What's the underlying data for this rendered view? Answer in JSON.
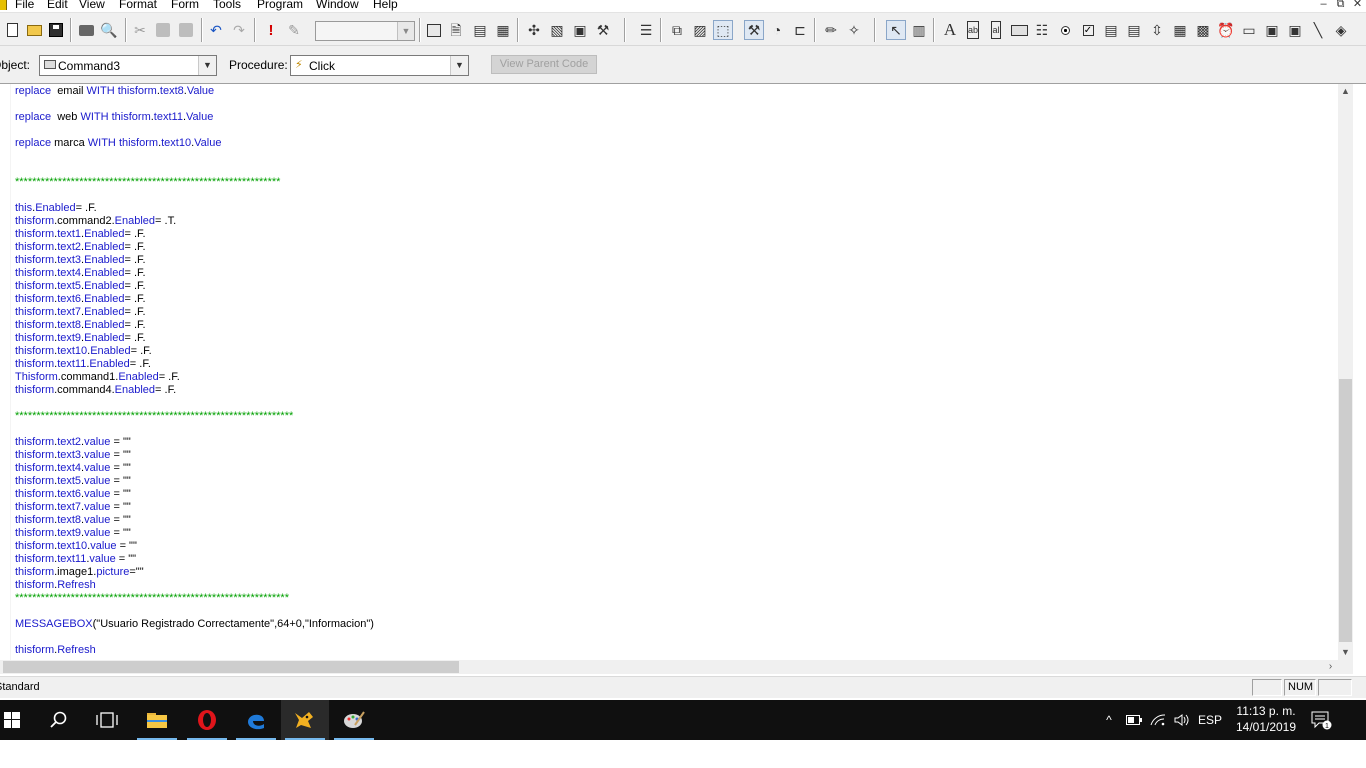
{
  "menubar": {
    "items": [
      "File",
      "Edit",
      "View",
      "Format",
      "Form",
      "Tools",
      "Program",
      "Window",
      "Help"
    ],
    "window_controls": [
      "–",
      "⧉",
      "✕"
    ]
  },
  "toolbar": {
    "combo_value": ""
  },
  "object_bar": {
    "object_label": "Object:",
    "object_value": "Command3",
    "procedure_label": "Procedure:",
    "procedure_value": "Click",
    "view_parent_label": "View Parent Code"
  },
  "code": {
    "lines": [
      [
        [
          "kw",
          "replace"
        ],
        [
          "pl",
          "  email "
        ],
        [
          "kw",
          "WITH"
        ],
        [
          "pl",
          " "
        ],
        [
          "kw",
          "thisform"
        ],
        [
          "pl",
          "."
        ],
        [
          "kw",
          "text8"
        ],
        [
          "pl",
          "."
        ],
        [
          "kw",
          "Value"
        ]
      ],
      [],
      [
        [
          "kw",
          "replace"
        ],
        [
          "pl",
          "  web "
        ],
        [
          "kw",
          "WITH"
        ],
        [
          "pl",
          " "
        ],
        [
          "kw",
          "thisform"
        ],
        [
          "pl",
          "."
        ],
        [
          "kw",
          "text11"
        ],
        [
          "pl",
          "."
        ],
        [
          "kw",
          "Value"
        ]
      ],
      [],
      [
        [
          "kw",
          "replace"
        ],
        [
          "pl",
          " marca "
        ],
        [
          "kw",
          "WITH"
        ],
        [
          "pl",
          " "
        ],
        [
          "kw",
          "thisform"
        ],
        [
          "pl",
          "."
        ],
        [
          "kw",
          "text10"
        ],
        [
          "pl",
          "."
        ],
        [
          "kw",
          "Value"
        ]
      ],
      [],
      [],
      [
        [
          "cm",
          "**************************************************************"
        ]
      ],
      [],
      [
        [
          "kw",
          "this"
        ],
        [
          "pl",
          "."
        ],
        [
          "kw",
          "Enabled"
        ],
        [
          "pl",
          "= .F."
        ]
      ],
      [
        [
          "kw",
          "thisform"
        ],
        [
          "pl",
          ".command2."
        ],
        [
          "kw",
          "Enabled"
        ],
        [
          "pl",
          "= .T."
        ]
      ],
      [
        [
          "kw",
          "thisform"
        ],
        [
          "pl",
          "."
        ],
        [
          "kw",
          "text1"
        ],
        [
          "pl",
          "."
        ],
        [
          "kw",
          "Enabled"
        ],
        [
          "pl",
          "= .F."
        ]
      ],
      [
        [
          "kw",
          "thisform"
        ],
        [
          "pl",
          "."
        ],
        [
          "kw",
          "text2"
        ],
        [
          "pl",
          "."
        ],
        [
          "kw",
          "Enabled"
        ],
        [
          "pl",
          "= .F."
        ]
      ],
      [
        [
          "kw",
          "thisform"
        ],
        [
          "pl",
          "."
        ],
        [
          "kw",
          "text3"
        ],
        [
          "pl",
          "."
        ],
        [
          "kw",
          "Enabled"
        ],
        [
          "pl",
          "= .F."
        ]
      ],
      [
        [
          "kw",
          "thisform"
        ],
        [
          "pl",
          "."
        ],
        [
          "kw",
          "text4"
        ],
        [
          "pl",
          "."
        ],
        [
          "kw",
          "Enabled"
        ],
        [
          "pl",
          "= .F."
        ]
      ],
      [
        [
          "kw",
          "thisform"
        ],
        [
          "pl",
          "."
        ],
        [
          "kw",
          "text5"
        ],
        [
          "pl",
          "."
        ],
        [
          "kw",
          "Enabled"
        ],
        [
          "pl",
          "= .F."
        ]
      ],
      [
        [
          "kw",
          "thisform"
        ],
        [
          "pl",
          "."
        ],
        [
          "kw",
          "text6"
        ],
        [
          "pl",
          "."
        ],
        [
          "kw",
          "Enabled"
        ],
        [
          "pl",
          "= .F."
        ]
      ],
      [
        [
          "kw",
          "thisform"
        ],
        [
          "pl",
          "."
        ],
        [
          "kw",
          "text7"
        ],
        [
          "pl",
          "."
        ],
        [
          "kw",
          "Enabled"
        ],
        [
          "pl",
          "= .F."
        ]
      ],
      [
        [
          "kw",
          "thisform"
        ],
        [
          "pl",
          "."
        ],
        [
          "kw",
          "text8"
        ],
        [
          "pl",
          "."
        ],
        [
          "kw",
          "Enabled"
        ],
        [
          "pl",
          "= .F."
        ]
      ],
      [
        [
          "kw",
          "thisform"
        ],
        [
          "pl",
          "."
        ],
        [
          "kw",
          "text9"
        ],
        [
          "pl",
          "."
        ],
        [
          "kw",
          "Enabled"
        ],
        [
          "pl",
          "= .F."
        ]
      ],
      [
        [
          "kw",
          "thisform"
        ],
        [
          "pl",
          "."
        ],
        [
          "kw",
          "text10"
        ],
        [
          "pl",
          "."
        ],
        [
          "kw",
          "Enabled"
        ],
        [
          "pl",
          "= .F."
        ]
      ],
      [
        [
          "kw",
          "thisform"
        ],
        [
          "pl",
          "."
        ],
        [
          "kw",
          "text11"
        ],
        [
          "pl",
          "."
        ],
        [
          "kw",
          "Enabled"
        ],
        [
          "pl",
          "= .F."
        ]
      ],
      [
        [
          "kw",
          "Thisform"
        ],
        [
          "pl",
          ".command1."
        ],
        [
          "kw",
          "Enabled"
        ],
        [
          "pl",
          "= .F."
        ]
      ],
      [
        [
          "kw",
          "thisform"
        ],
        [
          "pl",
          ".command4."
        ],
        [
          "kw",
          "Enabled"
        ],
        [
          "pl",
          "= .F."
        ]
      ],
      [],
      [
        [
          "cm",
          "*****************************************************************"
        ]
      ],
      [],
      [
        [
          "kw",
          "thisform"
        ],
        [
          "pl",
          "."
        ],
        [
          "kw",
          "text2"
        ],
        [
          "pl",
          "."
        ],
        [
          "kw",
          "value"
        ],
        [
          "pl",
          " = \"\""
        ]
      ],
      [
        [
          "kw",
          "thisform"
        ],
        [
          "pl",
          "."
        ],
        [
          "kw",
          "text3"
        ],
        [
          "pl",
          "."
        ],
        [
          "kw",
          "value"
        ],
        [
          "pl",
          " = \"\""
        ]
      ],
      [
        [
          "kw",
          "thisform"
        ],
        [
          "pl",
          "."
        ],
        [
          "kw",
          "text4"
        ],
        [
          "pl",
          "."
        ],
        [
          "kw",
          "value"
        ],
        [
          "pl",
          " = \"\""
        ]
      ],
      [
        [
          "kw",
          "thisform"
        ],
        [
          "pl",
          "."
        ],
        [
          "kw",
          "text5"
        ],
        [
          "pl",
          "."
        ],
        [
          "kw",
          "value"
        ],
        [
          "pl",
          " = \"\""
        ]
      ],
      [
        [
          "kw",
          "thisform"
        ],
        [
          "pl",
          "."
        ],
        [
          "kw",
          "text6"
        ],
        [
          "pl",
          "."
        ],
        [
          "kw",
          "value"
        ],
        [
          "pl",
          " = \"\""
        ]
      ],
      [
        [
          "kw",
          "thisform"
        ],
        [
          "pl",
          "."
        ],
        [
          "kw",
          "text7"
        ],
        [
          "pl",
          "."
        ],
        [
          "kw",
          "value"
        ],
        [
          "pl",
          " = \"\""
        ]
      ],
      [
        [
          "kw",
          "thisform"
        ],
        [
          "pl",
          "."
        ],
        [
          "kw",
          "text8"
        ],
        [
          "pl",
          "."
        ],
        [
          "kw",
          "value"
        ],
        [
          "pl",
          " = \"\""
        ]
      ],
      [
        [
          "kw",
          "thisform"
        ],
        [
          "pl",
          "."
        ],
        [
          "kw",
          "text9"
        ],
        [
          "pl",
          "."
        ],
        [
          "kw",
          "value"
        ],
        [
          "pl",
          " = \"\""
        ]
      ],
      [
        [
          "kw",
          "thisform"
        ],
        [
          "pl",
          "."
        ],
        [
          "kw",
          "text10"
        ],
        [
          "pl",
          "."
        ],
        [
          "kw",
          "value"
        ],
        [
          "pl",
          " = \"\""
        ]
      ],
      [
        [
          "kw",
          "thisform"
        ],
        [
          "pl",
          "."
        ],
        [
          "kw",
          "text11"
        ],
        [
          "pl",
          "."
        ],
        [
          "kw",
          "value"
        ],
        [
          "pl",
          " = \"\""
        ]
      ],
      [
        [
          "kw",
          "thisform"
        ],
        [
          "pl",
          ".image1."
        ],
        [
          "kw",
          "picture"
        ],
        [
          "pl",
          "=\"\""
        ]
      ],
      [
        [
          "kw",
          "thisform"
        ],
        [
          "pl",
          "."
        ],
        [
          "kw",
          "Refresh"
        ]
      ],
      [
        [
          "cm",
          "****************************************************************"
        ]
      ],
      [],
      [
        [
          "kw",
          "MESSAGEBOX"
        ],
        [
          "pl",
          "(\"Usuario Registrado Correctamente\",64+0,\"Informacion\")"
        ]
      ],
      [],
      [
        [
          "kw",
          "thisform"
        ],
        [
          "pl",
          "."
        ],
        [
          "kw",
          "Refresh"
        ]
      ]
    ]
  },
  "statusbar": {
    "text": "Standard",
    "num": "NUM"
  },
  "taskbar": {
    "language": "ESP",
    "time": "11:13 p. m.",
    "date": "14/01/2019",
    "notifications": "1"
  },
  "colors": {
    "keyword": "#1a1acc",
    "comment": "#00a000",
    "taskbar": "#101010"
  }
}
